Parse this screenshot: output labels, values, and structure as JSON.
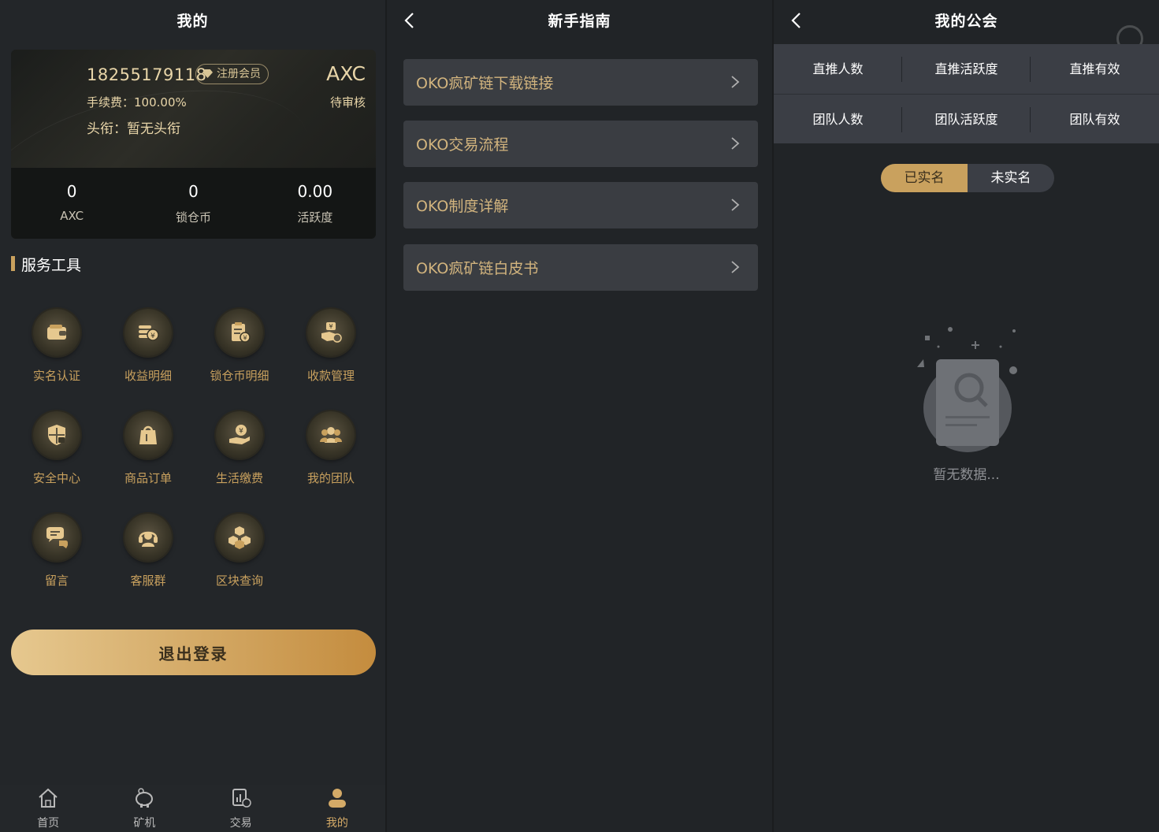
{
  "profile": {
    "title": "我的",
    "phone": "18255179118",
    "member_badge": "注册会员",
    "fee": "手续费：100.00%",
    "rank": "头衔：暂无头衔",
    "coin": "AXC",
    "status": "待审核",
    "stats": [
      {
        "value": "0",
        "label": "AXC"
      },
      {
        "value": "0",
        "label": "锁仓币"
      },
      {
        "value": "0.00",
        "label": "活跃度"
      }
    ],
    "section_title": "服务工具",
    "tools": [
      {
        "label": "实名认证",
        "icon": "wallet-icon"
      },
      {
        "label": "收益明细",
        "icon": "coins-icon"
      },
      {
        "label": "锁仓币明细",
        "icon": "clipboard-yen-icon"
      },
      {
        "label": "收款管理",
        "icon": "yen-hand-icon"
      },
      {
        "label": "安全中心",
        "icon": "shield-lock-icon"
      },
      {
        "label": "商品订单",
        "icon": "shopping-bag-icon"
      },
      {
        "label": "生活缴费",
        "icon": "pay-hand-icon"
      },
      {
        "label": "我的团队",
        "icon": "team-icon"
      },
      {
        "label": "留言",
        "icon": "chat-bubbles-icon"
      },
      {
        "label": "客服群",
        "icon": "headset-icon"
      },
      {
        "label": "区块查询",
        "icon": "blocks-icon"
      }
    ],
    "logout": "退出登录",
    "tabbar": [
      {
        "label": "首页",
        "icon": "home-icon",
        "active": false
      },
      {
        "label": "矿机",
        "icon": "piggy-bank-icon",
        "active": false
      },
      {
        "label": "交易",
        "icon": "trade-icon",
        "active": false
      },
      {
        "label": "我的",
        "icon": "user-icon",
        "active": true
      }
    ]
  },
  "guide": {
    "title": "新手指南",
    "items": [
      "OKO疯矿链下载链接",
      "OKO交易流程",
      "OKO制度详解",
      "OKO疯矿链白皮书"
    ]
  },
  "guild": {
    "title": "我的公会",
    "row1": [
      "直推人数",
      "直推活跃度",
      "直推有效"
    ],
    "row2": [
      "团队人数",
      "团队活跃度",
      "团队有效"
    ],
    "segments": [
      "已实名",
      "未实名"
    ],
    "empty_text": "暂无数据..."
  },
  "colors": {
    "gold": "#c9a15e",
    "bg": "#232629",
    "card_gold_text": "#e8d5a8"
  }
}
